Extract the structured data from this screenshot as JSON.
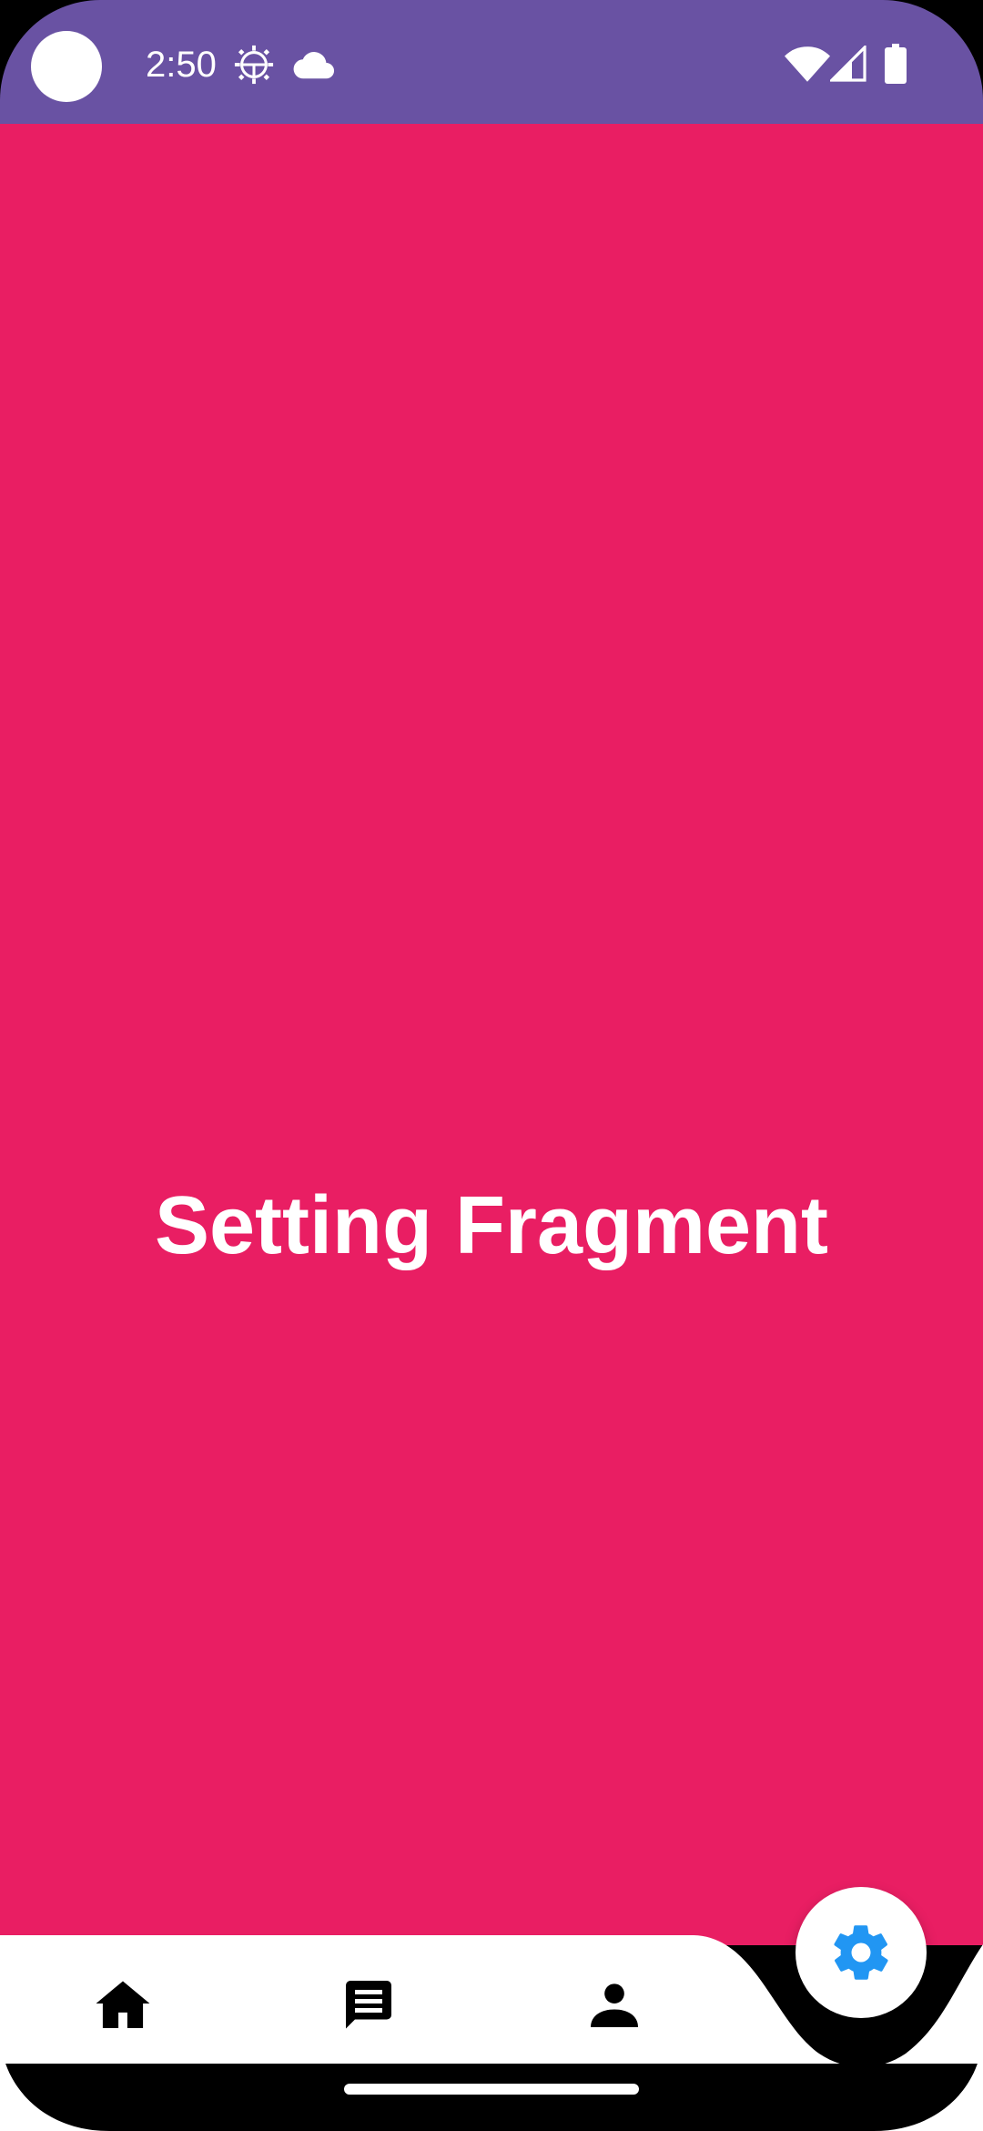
{
  "status_bar": {
    "time": "2:50",
    "background_color": "#6952A3",
    "left_icons": [
      "settings-gear-icon",
      "cloud-icon"
    ],
    "right_icons": [
      "wifi-icon",
      "cellular-signal-icon",
      "battery-icon"
    ]
  },
  "main": {
    "title": "Setting Fragment",
    "background_color": "#E91E63"
  },
  "bottom_nav": {
    "background_color": "#FFFFFF",
    "items": [
      {
        "icon": "home-icon"
      },
      {
        "icon": "chat-icon"
      },
      {
        "icon": "person-icon"
      }
    ],
    "fab": {
      "icon": "settings-gear-icon",
      "color": "#2196F3",
      "selected": true
    }
  }
}
